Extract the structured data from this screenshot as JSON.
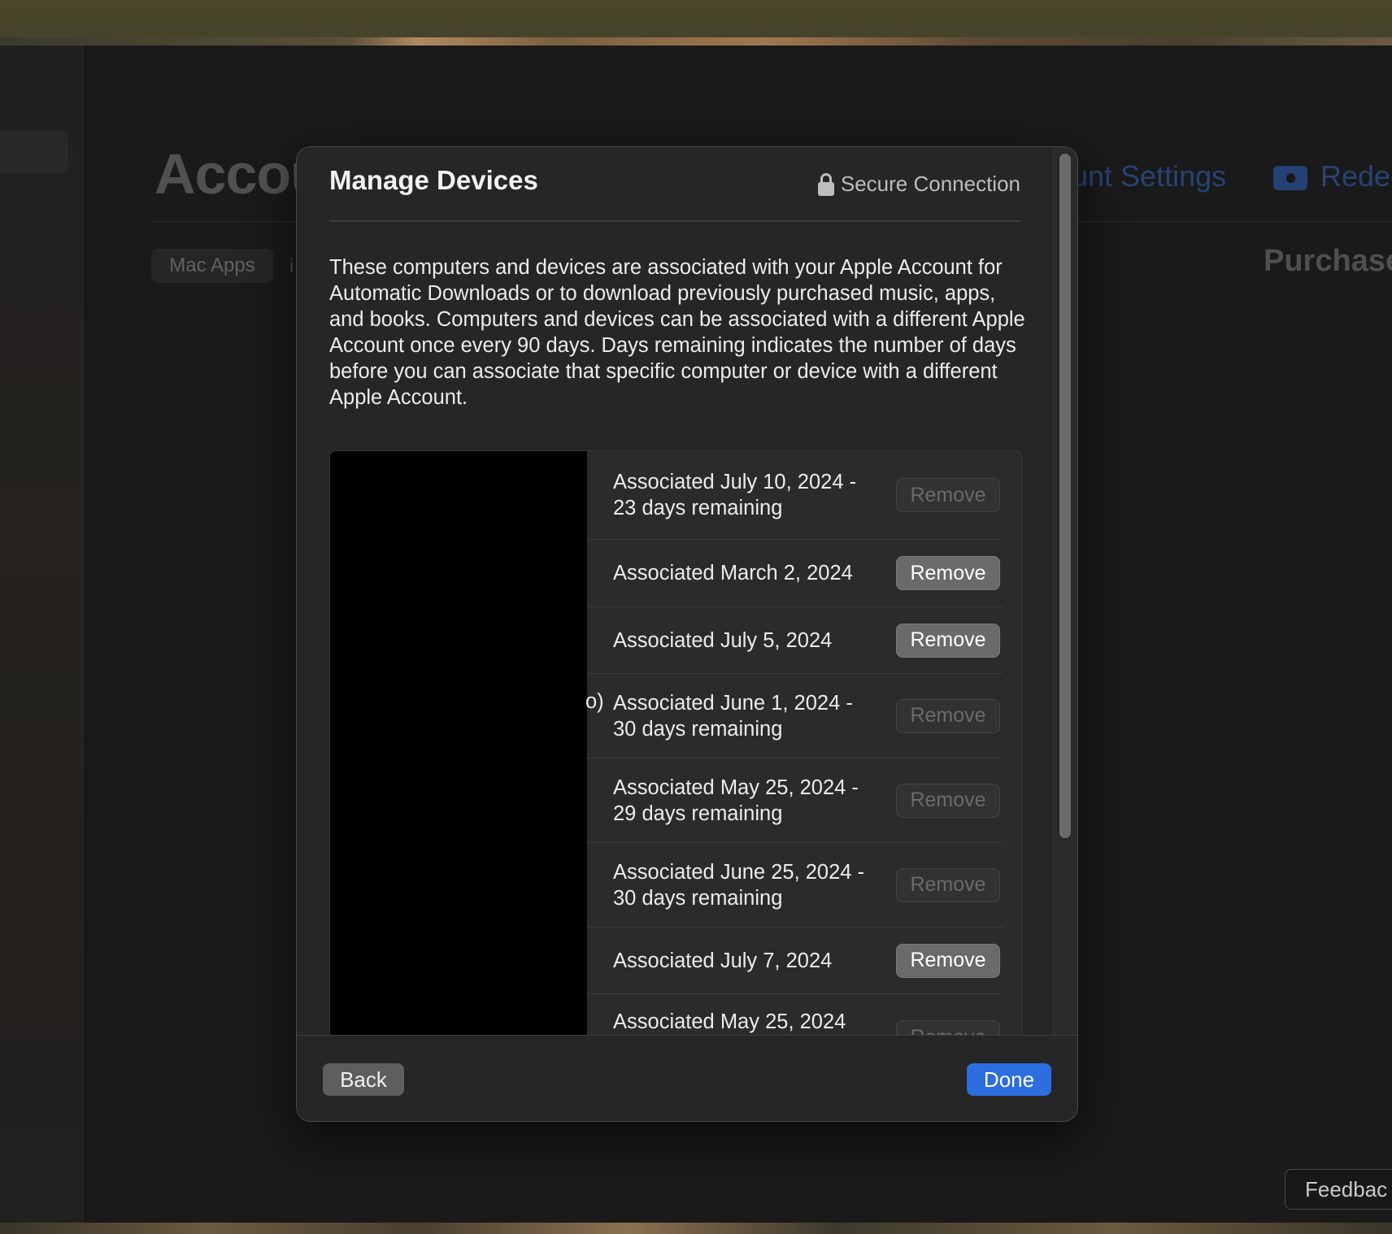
{
  "app": {
    "title": "Accou",
    "tab_mac_apps": "Mac Apps",
    "tab_partial": "i",
    "account_settings_link": "unt Settings",
    "redeem_link": "Redee",
    "purchased_heading": "Purchase",
    "feedback_button": "Feedbac"
  },
  "modal": {
    "title": "Manage Devices",
    "secure_connection": "Secure Connection",
    "description": "These computers and devices are associated with your Apple Account for Automatic Downloads or to download previously purchased music, apps, and books. Computers and devices can be associated with a different Apple Account once every 90 days. Days remaining indicates the number of days before you can associate that specific computer or device with a different Apple Account.",
    "rows": [
      {
        "label": "Associated July 10, 2024 - 23 days remaining",
        "button": "Remove",
        "enabled": false
      },
      {
        "label": "Associated March 2, 2024",
        "button": "Remove",
        "enabled": true
      },
      {
        "label": "Associated July 5, 2024",
        "button": "Remove",
        "enabled": true
      },
      {
        "label": "Associated June 1, 2024 - 30 days remaining",
        "prefix": "o)",
        "button": "Remove",
        "enabled": false
      },
      {
        "label": "Associated May 25, 2024 - 29 days remaining",
        "button": "Remove",
        "enabled": false
      },
      {
        "label": "Associated June 25, 2024 - 30 days remaining",
        "button": "Remove",
        "enabled": false
      },
      {
        "label": "Associated July 7, 2024",
        "button": "Remove",
        "enabled": true
      },
      {
        "label": "Associated May 25, 2024",
        "button": "Remove",
        "enabled": false
      }
    ],
    "back_button": "Back",
    "done_button": "Done"
  },
  "colors": {
    "accent": "#2c6de0",
    "link": "#2c4d86"
  }
}
